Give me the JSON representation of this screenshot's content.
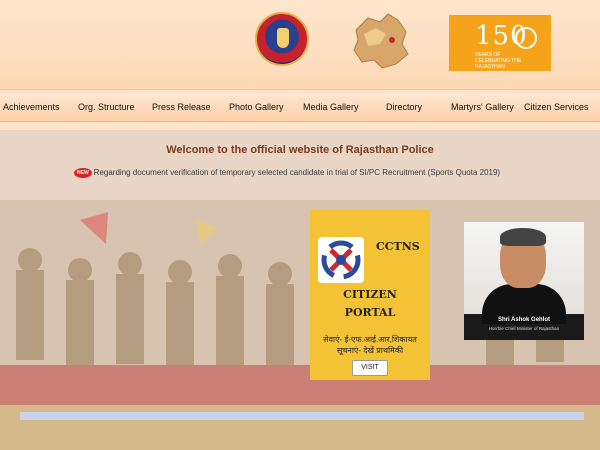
{
  "header": {
    "logo_police": "rajasthan-police-emblem",
    "logo_map": "rajasthan-map-logo",
    "logo_150": {
      "number": "150",
      "caption": "YEARS OF CELEBRATING THE RAJASTHAN"
    }
  },
  "nav": {
    "items": [
      {
        "label": "Achievements"
      },
      {
        "label": "Org. Structure"
      },
      {
        "label": "Press Release"
      },
      {
        "label": "Photo Gallery"
      },
      {
        "label": "Media Gallery"
      },
      {
        "label": "Directory"
      },
      {
        "label": "Martyrs' Gallery"
      },
      {
        "label": "Citizen Services"
      }
    ]
  },
  "main": {
    "welcome": "Welcome to the official website of Rajasthan Police",
    "ticker": {
      "badge": "NEW",
      "text": "Regarding document verification of temporary selected candidate in trial of SI/PC Recruitment (Sports Quota 2019)"
    },
    "cctns": {
      "title": "CCTNS",
      "line1": "CITIZEN",
      "line2": "PORTAL",
      "hindi1": "सेवाएं- ई-एफ.आई.आर,शिकायत",
      "hindi2": "सूचनाएं- देखें प्राथमिकी",
      "visit_label": "VISIT"
    },
    "cm": {
      "name": "Shri Ashok Gehlot",
      "role": "Hon'ble Chief Minister of Rajasthan"
    }
  },
  "colors": {
    "header_bg": "#fee6cd",
    "welcome_text": "#7a3b1c",
    "cctns_bg": "#f3c235",
    "logo_150_bg": "#f5a31b"
  }
}
